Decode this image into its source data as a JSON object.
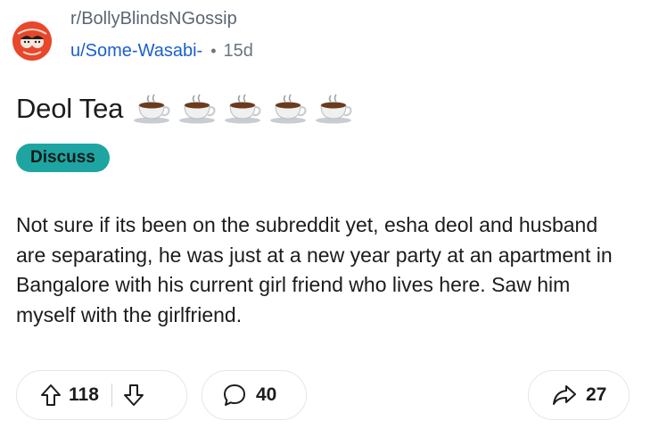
{
  "post": {
    "subreddit": "r/BollyBlindsNGossip",
    "author": "u/Some-Wasabi-",
    "separator": "•",
    "age": "15d",
    "title": "Deol Tea",
    "title_emoji": [
      "☕",
      "☕",
      "☕",
      "☕",
      "☕"
    ],
    "flair": "Discuss",
    "body": "Not sure if its been on the subreddit yet, esha deol and husband are separating, he was just at a new year party at an apartment in Bangalore with his current girl friend who lives here. Saw him myself with the girlfriend."
  },
  "actions": {
    "upvotes": "118",
    "comments": "40",
    "shares": "27"
  },
  "icons": {
    "avatar": "subreddit-avatar",
    "upvote": "arrow-up-icon",
    "downvote": "arrow-down-icon",
    "comment": "comment-bubble-icon",
    "share": "share-arrow-icon"
  },
  "colors": {
    "flair_bg": "#1ea5a2",
    "username": "#1a5fd0",
    "subreddit": "#5a6672",
    "avatar_bg": "#e8472b"
  }
}
